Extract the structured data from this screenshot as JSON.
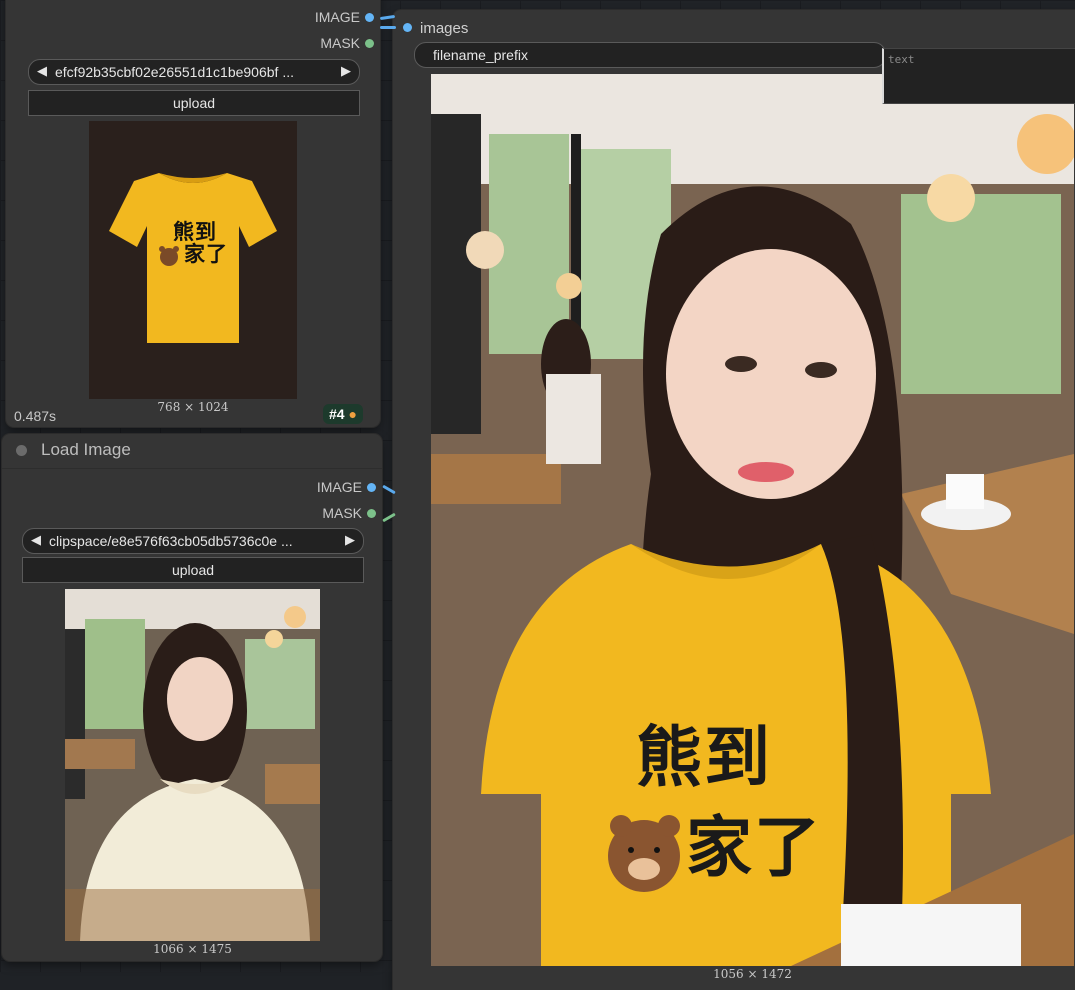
{
  "top_node": {
    "outputs": [
      {
        "label": "IMAGE",
        "type": "image"
      },
      {
        "label": "MASK",
        "type": "mask"
      }
    ],
    "image_combo": "efcf92b35cbf02e26551d1c1be906bf ...",
    "upload_label": "upload",
    "preview_dims": "768 × 1024",
    "exec_time": "0.487s",
    "node_id": "#4",
    "shirt_text": [
      "熊到",
      "家了"
    ]
  },
  "load_node": {
    "title": "Load Image",
    "outputs": [
      {
        "label": "IMAGE",
        "type": "image"
      },
      {
        "label": "MASK",
        "type": "mask"
      }
    ],
    "image_combo": "clipspace/e8e576f63cb05db5736c0e ...",
    "upload_label": "upload",
    "preview_dims": "1066 × 1475"
  },
  "save_node": {
    "input_label": "images",
    "filename_prefix_label": "filename_prefix",
    "text_placeholder": "text",
    "preview_dims": "1056 × 1472",
    "shirt_text": [
      "熊到",
      "家了"
    ]
  },
  "colors": {
    "image_slot": "#64b5f6",
    "mask_slot": "#7cc18a",
    "node_bg": "#353535",
    "canvas_bg": "#202327",
    "shirt_yellow": "#f2b81f"
  }
}
